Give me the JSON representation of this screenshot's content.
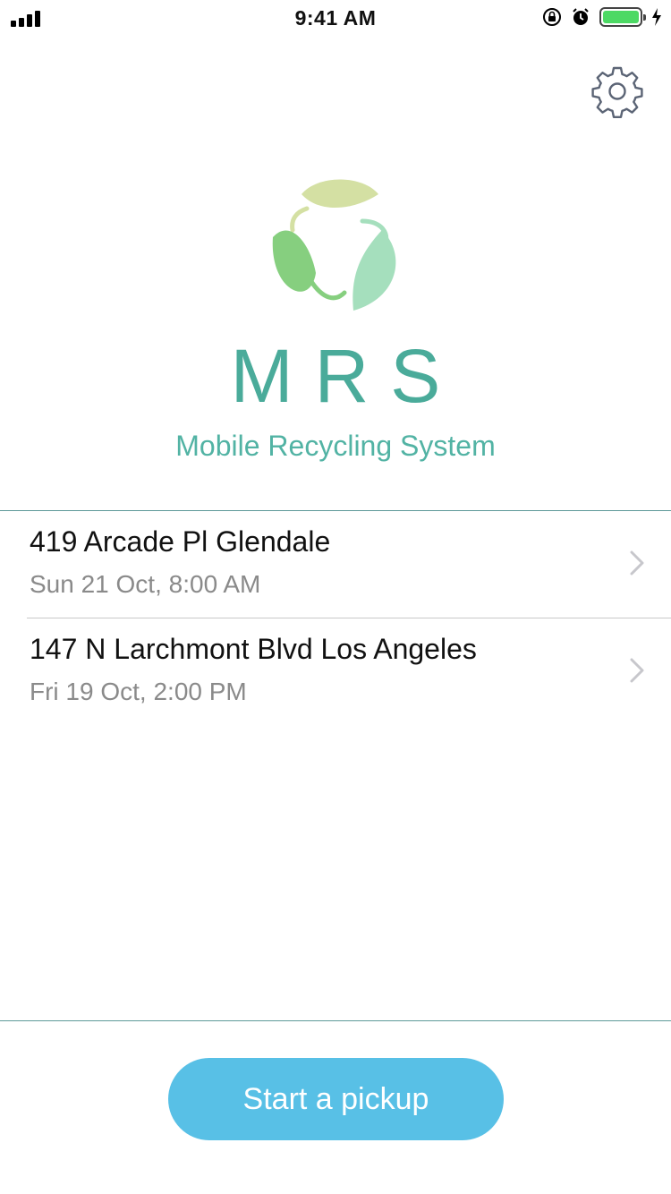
{
  "status_bar": {
    "time": "9:41 AM",
    "battery_level": 1.0,
    "icons": [
      "signal-icon",
      "orientation-lock-icon",
      "alarm-icon",
      "battery-icon",
      "charging-bolt-icon"
    ]
  },
  "header": {
    "settings_icon": "gear-icon"
  },
  "brand": {
    "title": "MRS",
    "subtitle": "Mobile Recycling System",
    "logo": "recycle-leaves-logo",
    "colors": {
      "title": "#4aab9a",
      "subtitle": "#52b3a4",
      "leaf_light": "#d4e0a3",
      "leaf_mid": "#86cf7f",
      "leaf_teal": "#a5dfbd"
    }
  },
  "pickups": [
    {
      "address": "419 Arcade Pl Glendale",
      "datetime": "Sun 21 Oct, 8:00 AM"
    },
    {
      "address": "147 N Larchmont Blvd Los Angeles",
      "datetime": "Fri 19 Oct, 2:00 PM"
    }
  ],
  "actions": {
    "start_label": "Start a pickup",
    "button_color": "#58c0e6"
  }
}
